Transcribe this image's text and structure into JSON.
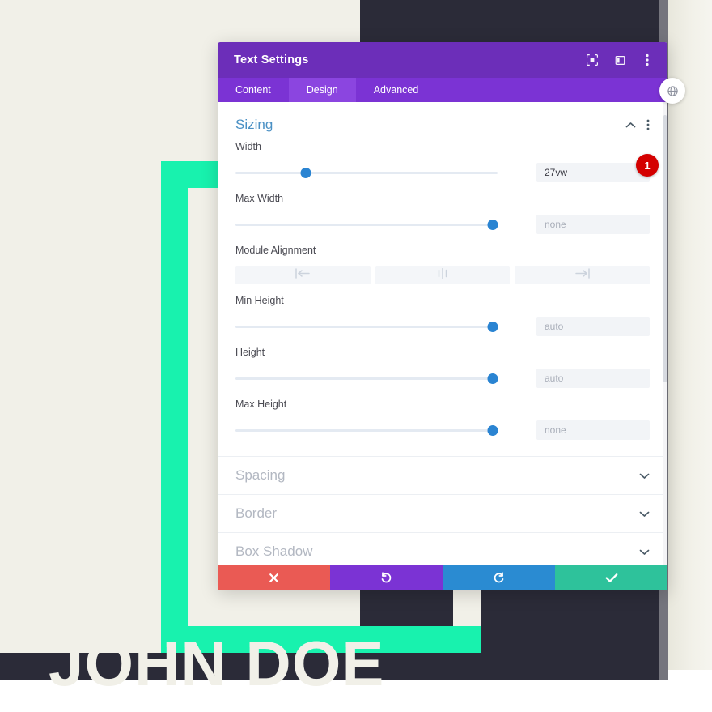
{
  "background": {
    "hero_name": "JOHN DOE",
    "colors": {
      "page_bg": "#f1f0e8",
      "dark_panel": "#2b2b38",
      "accent_teal": "#18f2ae"
    }
  },
  "globe_button": {
    "icon": "globe-icon"
  },
  "modal": {
    "title": "Text Settings",
    "titlebar_icons": [
      {
        "name": "focus-target-icon",
        "label": "Focus"
      },
      {
        "name": "panel-layout-icon",
        "label": "Layout"
      },
      {
        "name": "kebab-menu-icon",
        "label": "More options"
      }
    ],
    "tabs": [
      {
        "label": "Content",
        "active": false
      },
      {
        "label": "Design",
        "active": true
      },
      {
        "label": "Advanced",
        "active": false
      }
    ],
    "open_section": {
      "title": "Sizing",
      "collapse_icon": "chevron-up-icon",
      "menu_icon": "kebab-menu-icon",
      "fields": [
        {
          "type": "slider",
          "label": "Width",
          "value": "27vw",
          "is_placeholder": false,
          "thumb_percent": 27
        },
        {
          "type": "slider",
          "label": "Max Width",
          "value": "none",
          "is_placeholder": true,
          "thumb_percent": 98
        },
        {
          "type": "alignment",
          "label": "Module Alignment",
          "options": [
            {
              "name": "align-left-icon",
              "label": "Left"
            },
            {
              "name": "align-center-icon",
              "label": "Center"
            },
            {
              "name": "align-right-icon",
              "label": "Right"
            }
          ]
        },
        {
          "type": "slider",
          "label": "Min Height",
          "value": "auto",
          "is_placeholder": true,
          "thumb_percent": 98
        },
        {
          "type": "slider",
          "label": "Height",
          "value": "auto",
          "is_placeholder": true,
          "thumb_percent": 98
        },
        {
          "type": "slider",
          "label": "Max Height",
          "value": "none",
          "is_placeholder": true,
          "thumb_percent": 98
        }
      ]
    },
    "collapsed_sections": [
      {
        "title": "Spacing",
        "icon": "chevron-down-icon"
      },
      {
        "title": "Border",
        "icon": "chevron-down-icon"
      },
      {
        "title": "Box Shadow",
        "icon": "chevron-down-icon"
      }
    ],
    "footer_buttons": [
      {
        "name": "cancel-button",
        "icon": "close-x-icon",
        "color": "#ea5a54"
      },
      {
        "name": "undo-button",
        "icon": "undo-icon",
        "color": "#7b33d4"
      },
      {
        "name": "redo-button",
        "icon": "redo-icon",
        "color": "#2a8bd2"
      },
      {
        "name": "save-button",
        "icon": "checkmark-icon",
        "color": "#2ec29b"
      }
    ]
  },
  "badge": {
    "count": "1",
    "color": "#d40000"
  }
}
